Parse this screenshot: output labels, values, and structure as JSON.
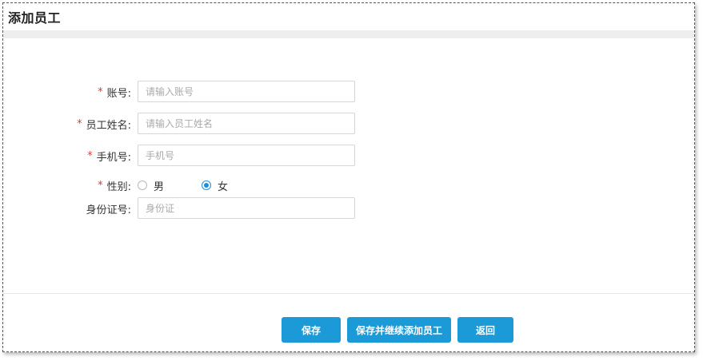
{
  "page": {
    "title": "添加员工"
  },
  "form": {
    "required_mark": "*",
    "account": {
      "label": "账号:",
      "placeholder": "请输入账号",
      "value": ""
    },
    "name": {
      "label": "员工姓名:",
      "placeholder": "请输入员工姓名",
      "value": ""
    },
    "phone": {
      "label": "手机号:",
      "placeholder": "手机号",
      "value": ""
    },
    "gender": {
      "label": "性别:",
      "options": [
        {
          "label": "男",
          "checked": false
        },
        {
          "label": "女",
          "checked": true
        }
      ]
    },
    "id_card": {
      "label": "身份证号:",
      "placeholder": "身份证",
      "value": ""
    }
  },
  "actions": {
    "save": "保存",
    "save_continue": "保存并继续添加员工",
    "back": "返回"
  },
  "colors": {
    "accent": "#1b9ad7",
    "required": "#e53935",
    "radio_checked": "#1a8fd8"
  }
}
